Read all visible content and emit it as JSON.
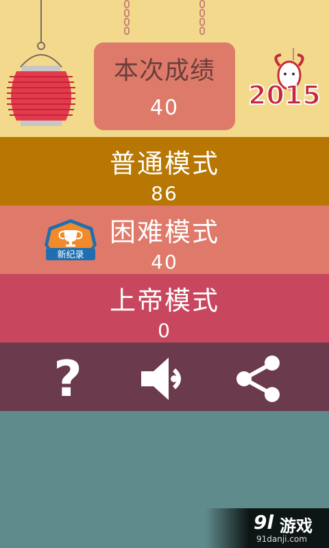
{
  "score_card": {
    "title": "本次成绩",
    "value": "40"
  },
  "year_badge": {
    "text": "2015",
    "icon": "goat-icon"
  },
  "modes": [
    {
      "label": "普通模式",
      "value": "86",
      "color": "#b77702"
    },
    {
      "label": "困难模式",
      "value": "40",
      "color": "#df796a"
    },
    {
      "label": "上帝模式",
      "value": "0",
      "color": "#c9475e"
    }
  ],
  "new_record_badge": {
    "text": "新纪录",
    "icon": "trophy-icon"
  },
  "toolbar": {
    "help_label": "?",
    "help_icon": "question-icon",
    "sound_icon": "speaker-icon",
    "share_icon": "share-icon"
  },
  "watermark": {
    "logo": "9l",
    "name": "游戏",
    "url": "91danji.com"
  },
  "colors": {
    "background_top": "#f2d98b",
    "score_card": "#de7a6a",
    "toolbar": "#6b3a4d",
    "background_bottom": "#5f8b8d"
  }
}
